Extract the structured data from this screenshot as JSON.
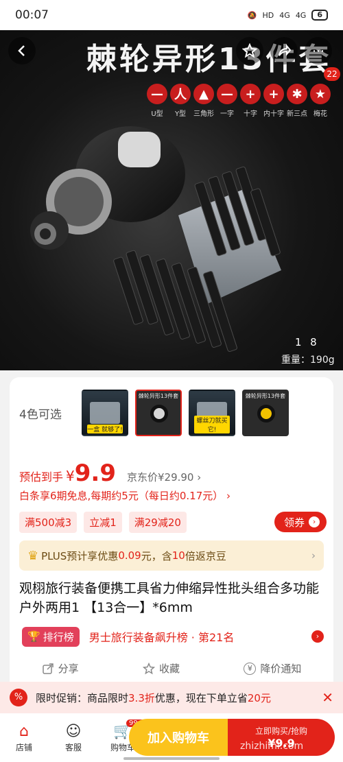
{
  "status_bar": {
    "time": "00:07",
    "network_1": "4G",
    "network_2": "4G",
    "battery": "6"
  },
  "hero": {
    "title": "棘轮异形13件套",
    "badge_count": "22",
    "bit_types": [
      {
        "symbol": "—",
        "label": "U型"
      },
      {
        "symbol": "人",
        "label": "Y型"
      },
      {
        "symbol": "▲",
        "label": "三角形"
      },
      {
        "symbol": "—",
        "label": "一字"
      },
      {
        "symbol": "+",
        "label": "十字"
      },
      {
        "symbol": "+",
        "label": "内十字"
      },
      {
        "symbol": "✱",
        "label": "新三点"
      },
      {
        "symbol": "★",
        "label": "梅花"
      }
    ],
    "image_index": "1",
    "image_total": "8",
    "weight": "重量：190g"
  },
  "variants": {
    "label": "4色可选",
    "thumbs": [
      {
        "top": "",
        "caption": "一盒 就够了!"
      },
      {
        "top": "棘轮异形13件套",
        "caption": ""
      },
      {
        "top": "",
        "caption": "螺丝刀就买它!"
      },
      {
        "top": "棘轮异形13件套",
        "caption": ""
      }
    ]
  },
  "price": {
    "label": "预估到手",
    "yen": "¥",
    "value": "9.9",
    "jd_price": "京东价¥29.90 ›"
  },
  "installment": "白条享6期免息,每期约5元（每日约0.17元） ›",
  "coupons": [
    "满500减3",
    "立减1",
    "满29减20"
  ],
  "claim_coupon": "领券",
  "plus": {
    "prefix": "PLUS预计享优惠",
    "amount": "0.09",
    "middle": "元，含",
    "multiplier": "10",
    "suffix": "倍返京豆"
  },
  "product_title": "观栩旅行装备便携工具省力伸缩异性批头组合多功能户外两用1 【13合一】*6mm",
  "ranking": {
    "badge": "排行榜",
    "text": "男士旅行装备飙升榜 · 第21名"
  },
  "actions": [
    {
      "icon": "share-icon",
      "label": "分享"
    },
    {
      "icon": "star-icon",
      "label": "收藏"
    },
    {
      "icon": "price-alert-icon",
      "label": "降价通知"
    }
  ],
  "promo": {
    "label": "限时促销：商品限时",
    "discount": "3.3折",
    "mid": "优惠，现在下单立省",
    "save": "20元"
  },
  "bottom_tabs": [
    {
      "icon": "store-icon",
      "label": "店铺"
    },
    {
      "icon": "service-icon",
      "label": "客服"
    },
    {
      "icon": "cart-icon",
      "label": "购物车",
      "badge": "99+"
    }
  ],
  "add_to_cart": "加入购物车",
  "buy_now": {
    "line1": "立即购买/抢购",
    "line2": "¥9.9"
  },
  "watermark": "zhizhimi.com"
}
